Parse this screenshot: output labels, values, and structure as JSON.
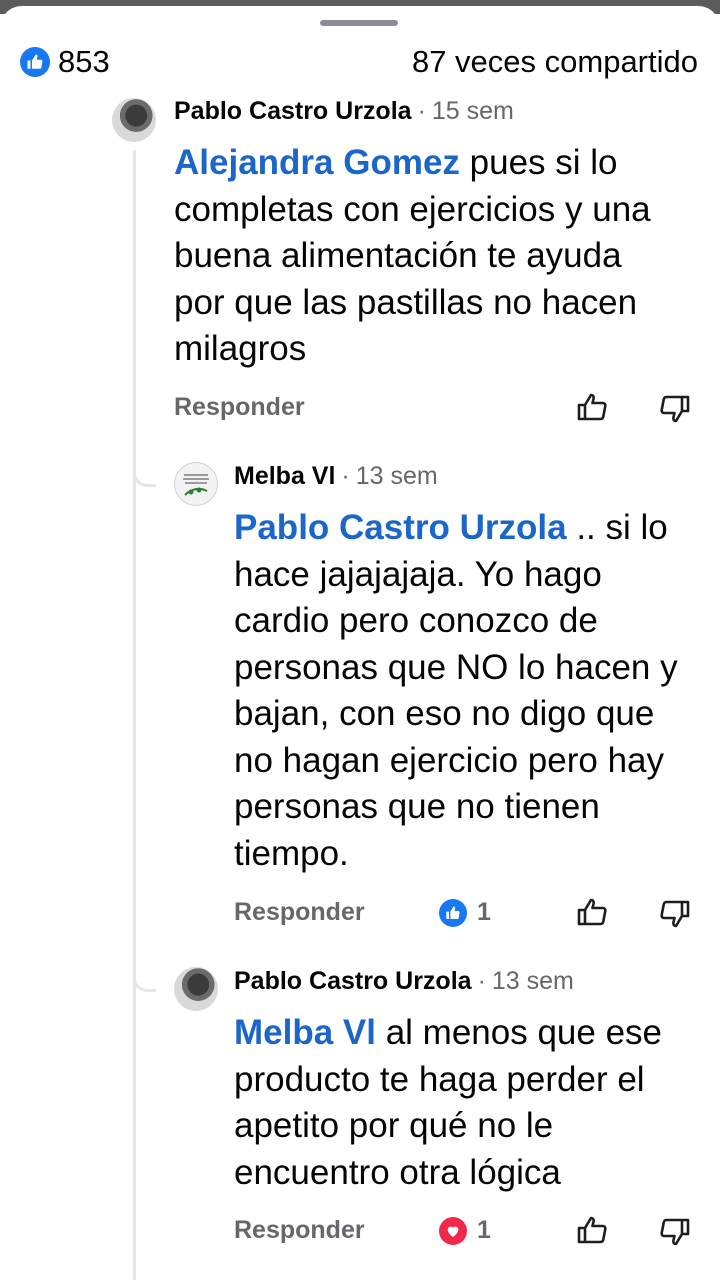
{
  "summary": {
    "likes": "853",
    "shares": "87 veces compartido"
  },
  "comments": [
    {
      "author": "Pablo Castro Urzola",
      "separator": "·",
      "time": "15 sem",
      "mention": "Alejandra Gomez",
      "text_lines": [
        "pues si lo",
        "completas con ejercicios y una",
        "buena alimentación te ayuda",
        "por que las pastillas no hacen",
        "milagros"
      ],
      "reply_label": "Responder"
    },
    {
      "author": "Melba Vl",
      "separator": "·",
      "time": "13 sem",
      "mention": "Pablo Castro Urzola",
      "text_lines": [
        ".. si lo",
        "hace jajajajaja. Yo hago",
        "cardio pero conozco de",
        "personas que NO lo hacen y",
        "bajan, con eso no digo que",
        "no hagan ejercicio pero hay",
        "personas que no tienen",
        "tiempo."
      ],
      "reply_label": "Responder",
      "reaction_count": "1"
    },
    {
      "author": "Pablo Castro Urzola",
      "separator": "·",
      "time": "13 sem",
      "mention": "Melba Vl",
      "text_lines": [
        "al menos que ese",
        "producto te haga perder el",
        "apetito por qué no le",
        "encuentro otra lógica"
      ],
      "reply_label": "Responder",
      "reaction_count": "1"
    }
  ]
}
